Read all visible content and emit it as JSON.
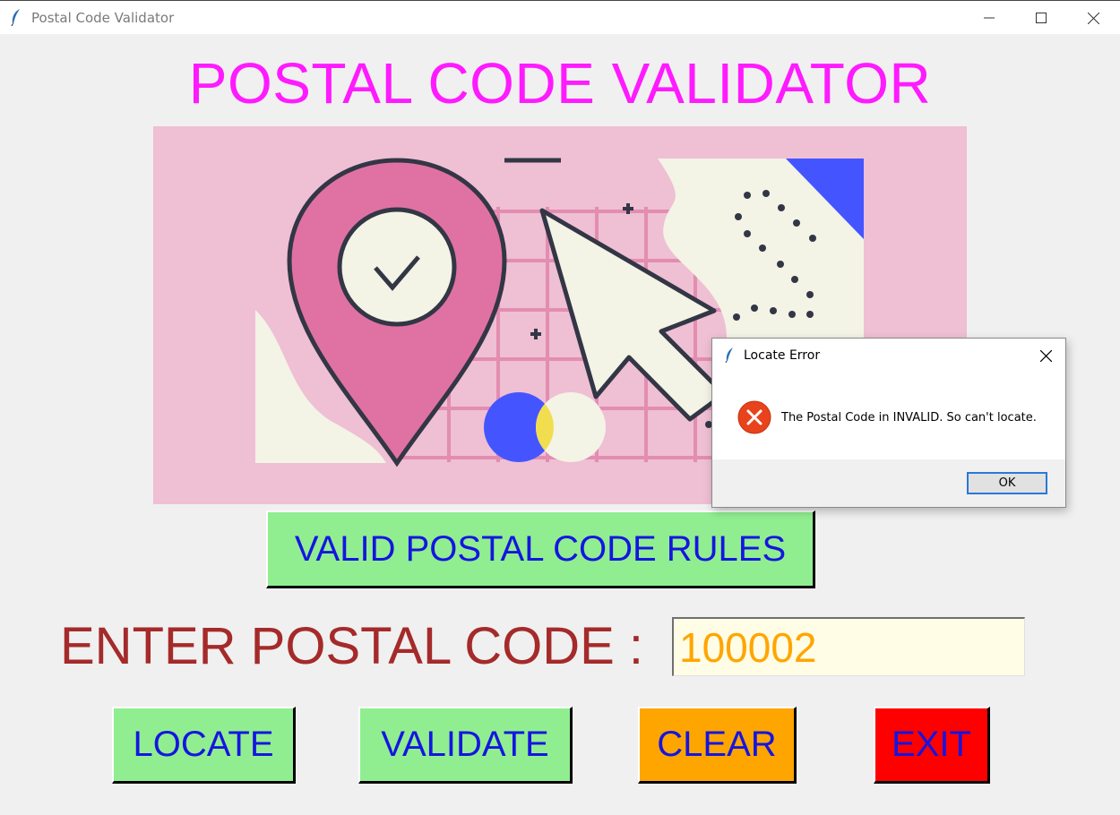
{
  "window": {
    "title": "Postal Code Validator",
    "icon": "feather-icon"
  },
  "heading": "POSTAL CODE VALIDATOR",
  "buttons": {
    "rules": "VALID POSTAL CODE RULES",
    "locate": "LOCATE",
    "validate": "VALIDATE",
    "clear": "CLEAR",
    "exit": "EXIT"
  },
  "form": {
    "label": "ENTER POSTAL CODE :",
    "value": "100002"
  },
  "dialog": {
    "title": "Locate Error",
    "message": "The Postal Code in INVALID. So can't locate.",
    "ok_label": "OK",
    "icon": "error-icon"
  },
  "colors": {
    "heading": "#ff1aff",
    "button_green": "#90ee90",
    "button_orange": "#ffa500",
    "button_red": "#ff0000",
    "button_text": "#1515e0",
    "label": "#a52a2a",
    "input_text": "#ffa500",
    "input_bg": "#fffde6",
    "banner_bg": "#efbfd4"
  }
}
